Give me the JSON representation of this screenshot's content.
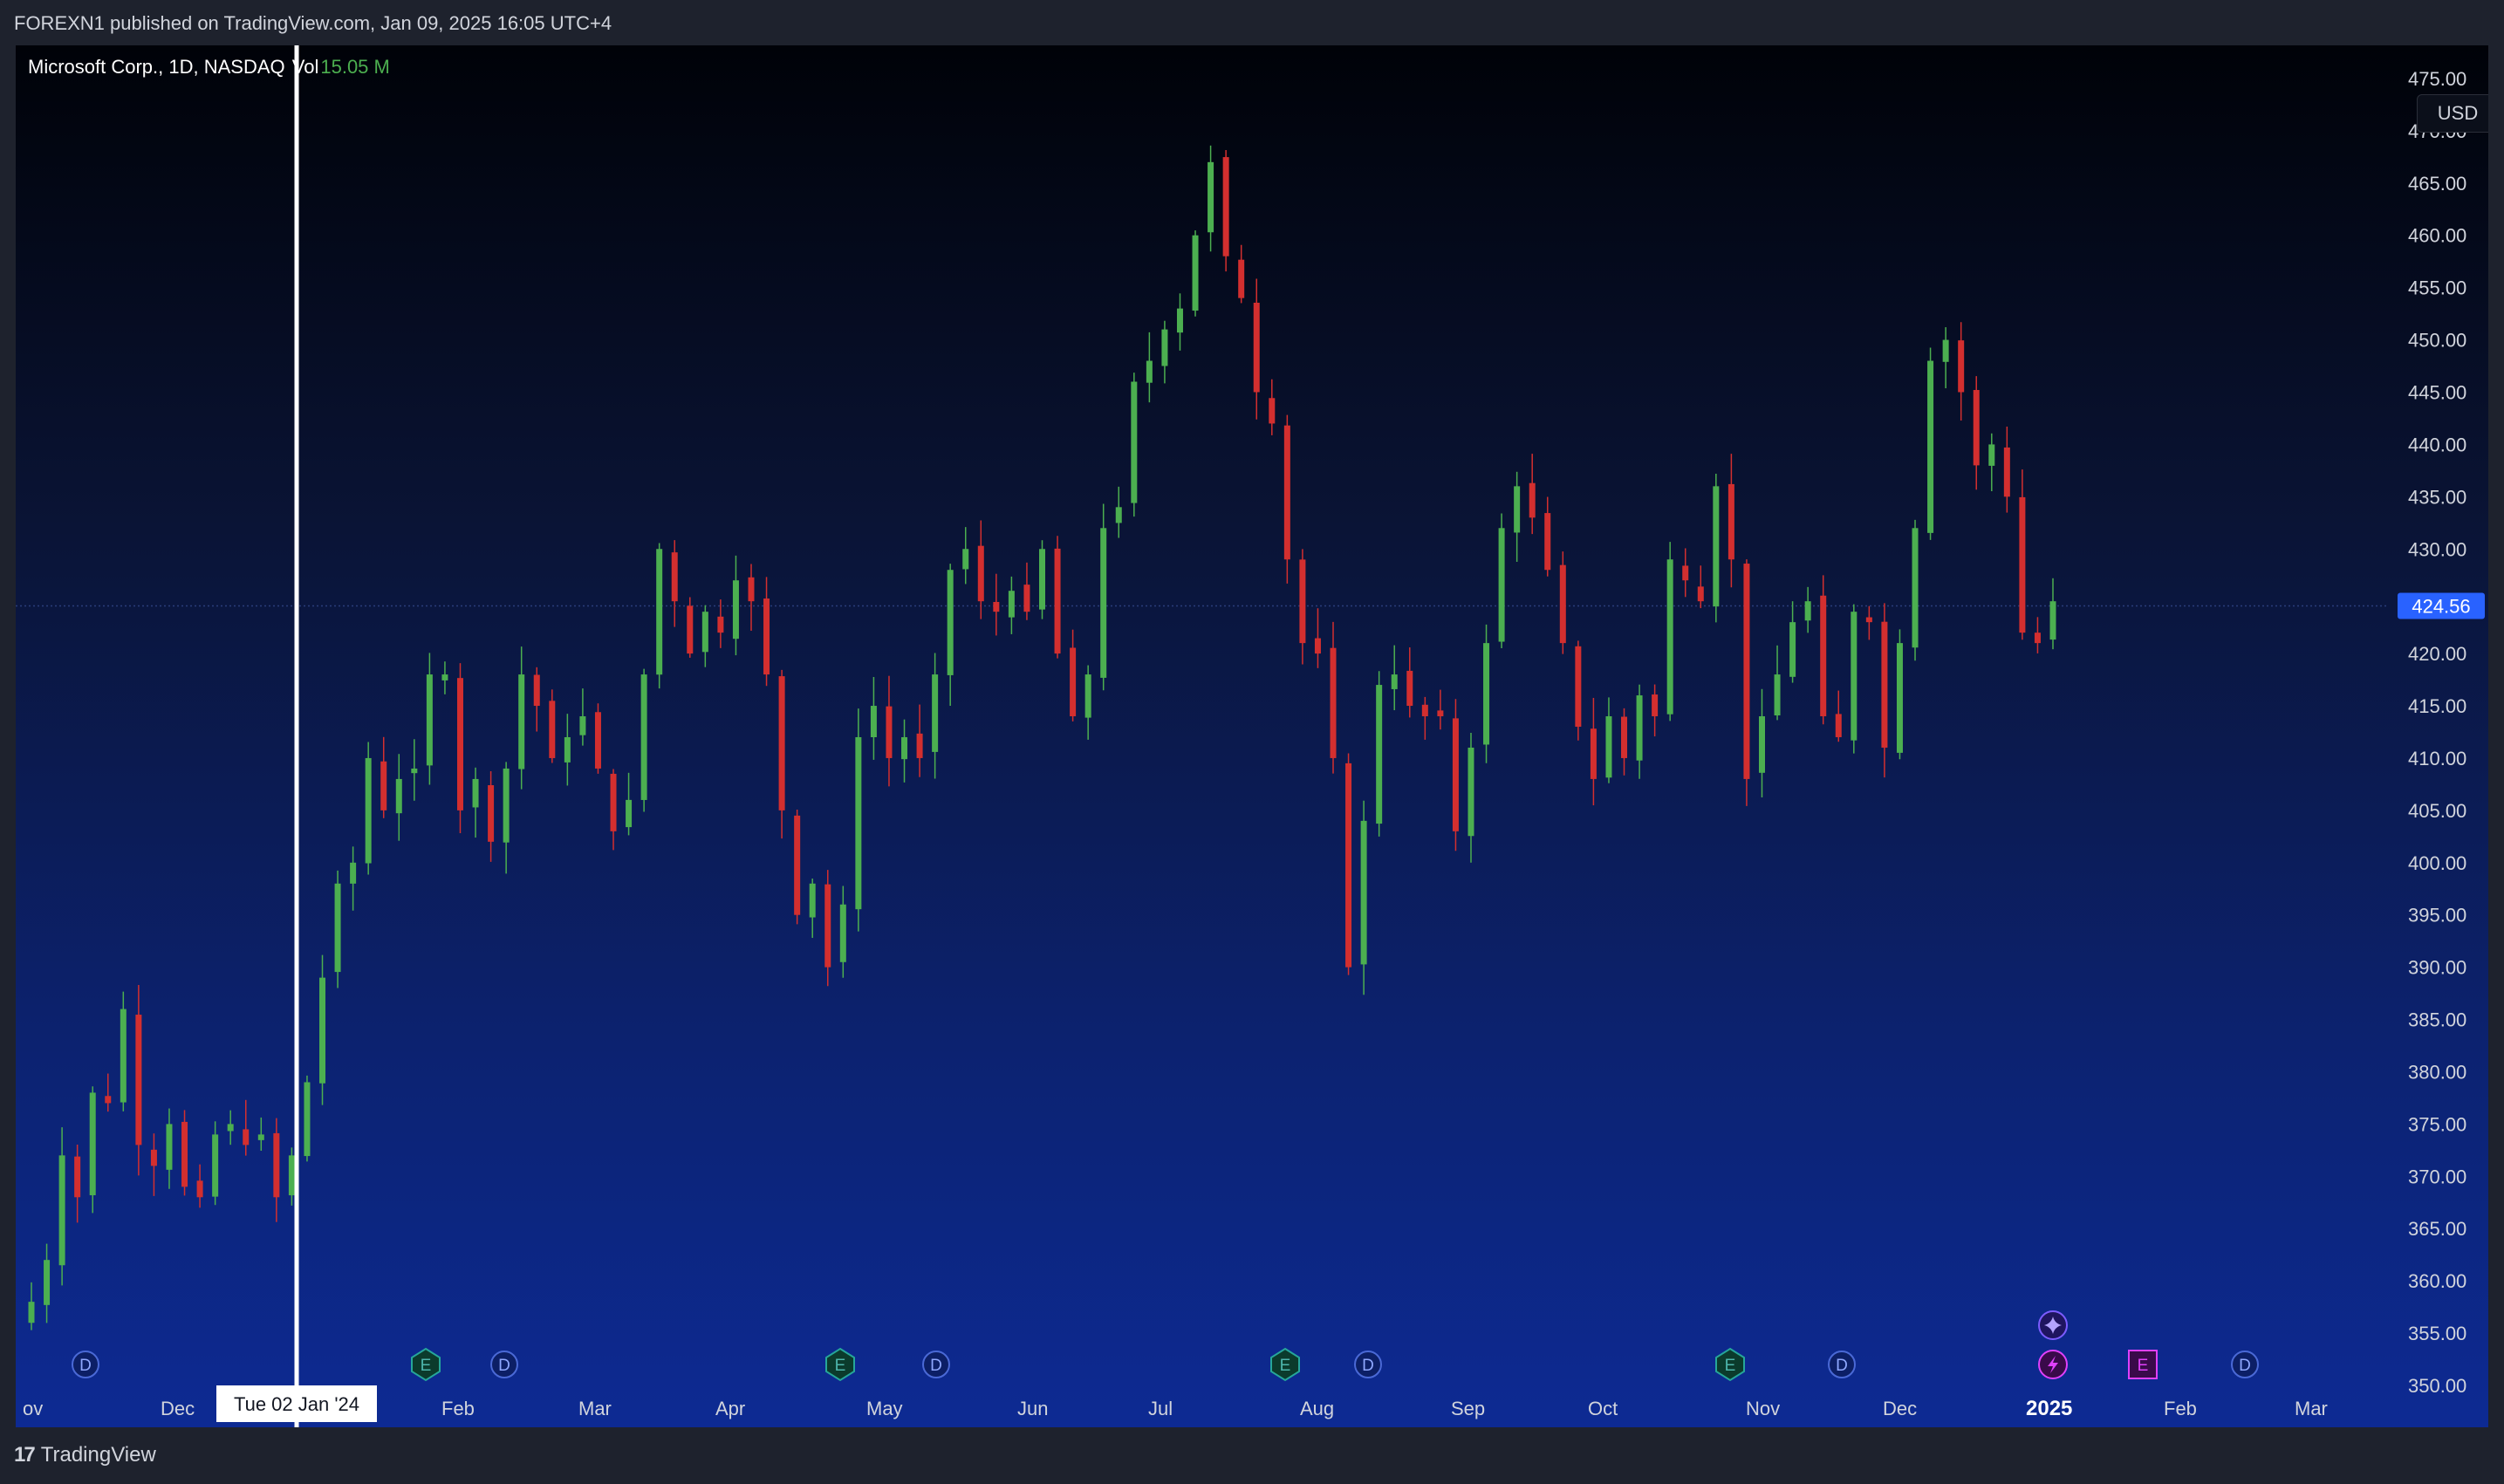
{
  "header": {
    "published": "FOREXN1 published on TradingView.com, Jan 09, 2025 16:05 UTC+4"
  },
  "legend": {
    "symbol": "Microsoft Corp., 1D, NASDAQ",
    "vol_label": "Vol",
    "vol_value": "15.05 M"
  },
  "currency_button": "USD",
  "branding": {
    "name": "TradingView",
    "logo": "17"
  },
  "colors": {
    "up": "#4caf50",
    "down": "#d32f2f",
    "price_label": "#2962ff",
    "crosshair": "#ffffff"
  },
  "chart_data": {
    "type": "candlestick",
    "y_ticks": [
      "475.00",
      "470.00",
      "465.00",
      "460.00",
      "455.00",
      "450.00",
      "445.00",
      "440.00",
      "435.00",
      "430.00",
      "425.00",
      "420.00",
      "415.00",
      "410.00",
      "405.00",
      "400.00",
      "395.00",
      "390.00",
      "385.00",
      "380.00",
      "375.00",
      "370.00",
      "365.00",
      "360.00",
      "355.00",
      "350.00"
    ],
    "ylim": [
      349,
      477.5
    ],
    "last_price": "424.56",
    "x_labels": [
      "ov",
      "Dec",
      "Feb",
      "Mar",
      "Apr",
      "May",
      "Jun",
      "Jul",
      "Aug",
      "Sep",
      "Oct",
      "Nov",
      "Dec",
      "2025",
      "Feb",
      "Mar"
    ],
    "crosshair_label": "Tue 02 Jan '24",
    "path": [
      358,
      362,
      372,
      368,
      378,
      377,
      386,
      373,
      371,
      375,
      369,
      368,
      374,
      375,
      373,
      374,
      368,
      372,
      379,
      389,
      398,
      400,
      410,
      405,
      408,
      409,
      418,
      418,
      405,
      408,
      402,
      409,
      418,
      415,
      410,
      412,
      414,
      409,
      403,
      406,
      418,
      430,
      425,
      420,
      424,
      422,
      427,
      425,
      418,
      405,
      395,
      398,
      390,
      396,
      412,
      415,
      410,
      412,
      410,
      418,
      428,
      430,
      425,
      424,
      426,
      424,
      430,
      420,
      414,
      418,
      432,
      434,
      446,
      448,
      451,
      453,
      460,
      467,
      458,
      454,
      445,
      442,
      429,
      421,
      420,
      410,
      390,
      404,
      417,
      418,
      415,
      414,
      414,
      403,
      411,
      421,
      432,
      436,
      433,
      428,
      421,
      413,
      408,
      414,
      410,
      416,
      414,
      429,
      427,
      425,
      436,
      429,
      408,
      414,
      418,
      423,
      425,
      414,
      412,
      424,
      423,
      411,
      421,
      432,
      448,
      450,
      445,
      438,
      440,
      435,
      422,
      421,
      425
    ],
    "events": [
      {
        "type": "D",
        "x": "Dec"
      },
      {
        "type": "E",
        "x": "Jan"
      },
      {
        "type": "D",
        "x": "Feb"
      },
      {
        "type": "E",
        "x": "Apr"
      },
      {
        "type": "D",
        "x": "May"
      },
      {
        "type": "E",
        "x": "Jul"
      },
      {
        "type": "D",
        "x": "Aug"
      },
      {
        "type": "E",
        "x": "Oct"
      },
      {
        "type": "D",
        "x": "Nov"
      },
      {
        "type": "split",
        "x": "2025"
      },
      {
        "type": "E",
        "x": "Jan"
      },
      {
        "type": "D",
        "x": "Feb"
      },
      {
        "type": "spark",
        "x": "2025"
      }
    ]
  }
}
